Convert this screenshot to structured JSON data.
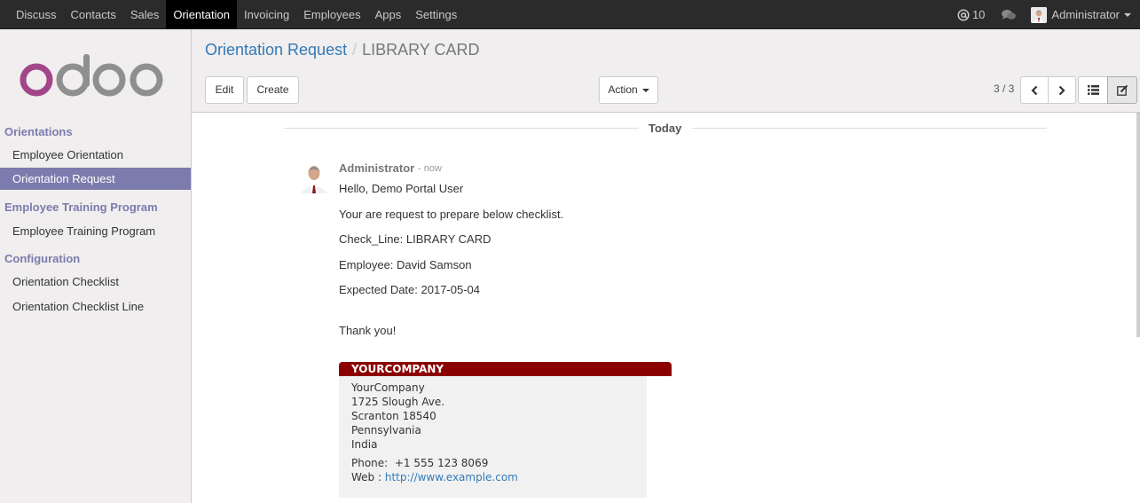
{
  "topbar": {
    "menu": [
      "Discuss",
      "Contacts",
      "Sales",
      "Orientation",
      "Invoicing",
      "Employees",
      "Apps",
      "Settings"
    ],
    "active_menu": "Orientation",
    "mention_count": "10",
    "user_name": "Administrator"
  },
  "sidebar": {
    "logo_text": "odoo",
    "sections": [
      {
        "title": "Orientations",
        "items": [
          "Employee Orientation",
          "Orientation Request"
        ]
      },
      {
        "title": "Employee Training Program",
        "items": [
          "Employee Training Program"
        ]
      },
      {
        "title": "Configuration",
        "items": [
          "Orientation Checklist",
          "Orientation Checklist Line"
        ]
      }
    ],
    "active_item": "Orientation Request"
  },
  "control_panel": {
    "breadcrumb_parent": "Orientation Request",
    "breadcrumb_separator": "/",
    "breadcrumb_current": "LIBRARY CARD",
    "edit_label": "Edit",
    "create_label": "Create",
    "action_label": "Action",
    "pager": "3 / 3"
  },
  "thread": {
    "date_separator": "Today",
    "message": {
      "author": "Administrator",
      "date": "- now",
      "lines": [
        "Hello, Demo Portal User",
        "Your are request to prepare below checklist.",
        "Check_Line: LIBRARY CARD",
        "Employee: David Samson",
        "Expected Date: 2017-05-04",
        "Thank you!"
      ]
    },
    "signature": {
      "header": "YOURCOMPANY",
      "company": "YourCompany",
      "street": "1725 Slough Ave.",
      "city": "Scranton 18540",
      "state": "Pennsylvania",
      "country": "India",
      "phone_label": "Phone:",
      "phone": "+1 555 123 8069",
      "web_label": "Web :",
      "web": "http://www.example.com"
    }
  },
  "colors": {
    "topbar_bg": "#2b2b2b",
    "accent": "#7c7bad",
    "link": "#337ab7",
    "signature_header": "#8b0000",
    "logo_o1": "#a24689",
    "logo_gray": "#8f8f8f"
  }
}
